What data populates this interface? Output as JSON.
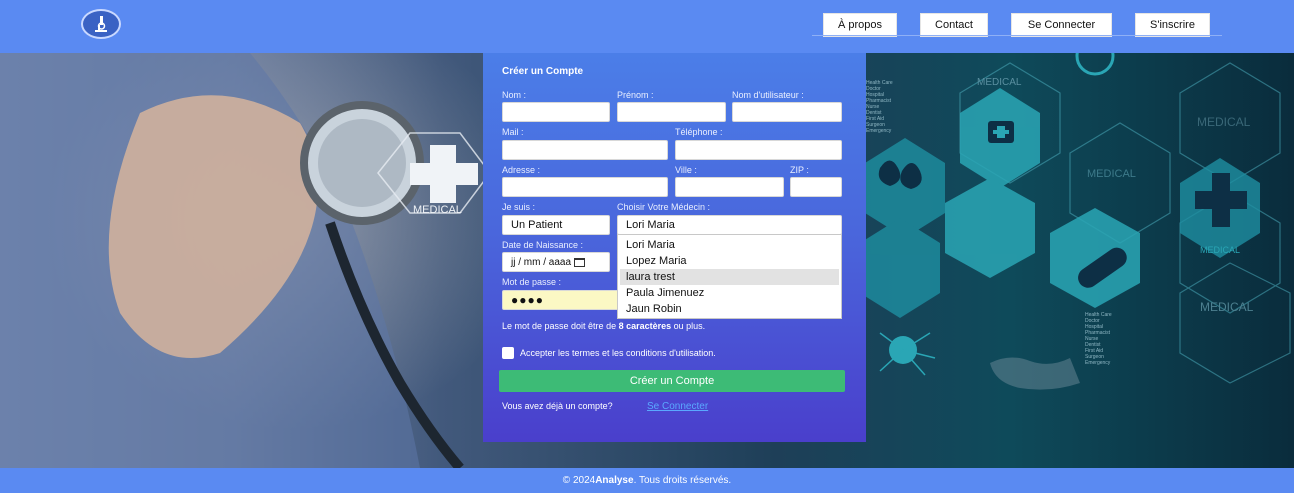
{
  "nav": {
    "about": "À propos",
    "contact": "Contact",
    "login": "Se Connecter",
    "signup": "S'inscrire"
  },
  "hero": {
    "medical_words": [
      "MEDICAL",
      "MEDICAL",
      "MEDICAL",
      "MEDICAL",
      "MEDICAL",
      "MEDICAL"
    ],
    "small_list": [
      "Health Care",
      "Doctor",
      "Hospital",
      "Pharmacist",
      "Nurse",
      "Dentist",
      "First Aid",
      "Surgeon",
      "Emergency"
    ]
  },
  "form": {
    "title": "Créer un Compte",
    "labels": {
      "nom": "Nom :",
      "prenom": "Prénom :",
      "username": "Nom d'utilisateur :",
      "mail": "Mail :",
      "telephone": "Téléphone :",
      "adresse": "Adresse :",
      "ville": "Ville :",
      "zip": "ZIP :",
      "je_suis": "Je suis :",
      "medecin": "Choisir Votre Médecin :",
      "naissance": "Date de Naissance :",
      "password": "Mot de passe :"
    },
    "values": {
      "je_suis": "Un Patient",
      "medecin": "Lori Maria",
      "naissance_placeholder": "jj / mm / aaaa",
      "password_mask": "●●●●"
    },
    "doctor_options": [
      "Lori Maria",
      "Lopez Maria",
      "laura trest",
      "Paula Jimenuez",
      "Jaun Robin"
    ],
    "highlighted_option": "laura trest",
    "password_hint_before": "Le mot de passe doit être de ",
    "password_hint_bold": "8 caractères",
    "password_hint_after": " ou plus.",
    "terms_label": "Accepter les termes et les conditions d'utilisation.",
    "submit_label": "Créer un Compte",
    "already_text": "Vous avez déjà un compte?",
    "login_link": "Se Connecter"
  },
  "footer": {
    "prefix": "© 2024 ",
    "brand": "Analyse",
    "suffix": ". Tous droits réservés."
  },
  "colors": {
    "header": "#5a8af2",
    "button_green": "#3dbb76",
    "link_blue": "#5aa8ff"
  }
}
